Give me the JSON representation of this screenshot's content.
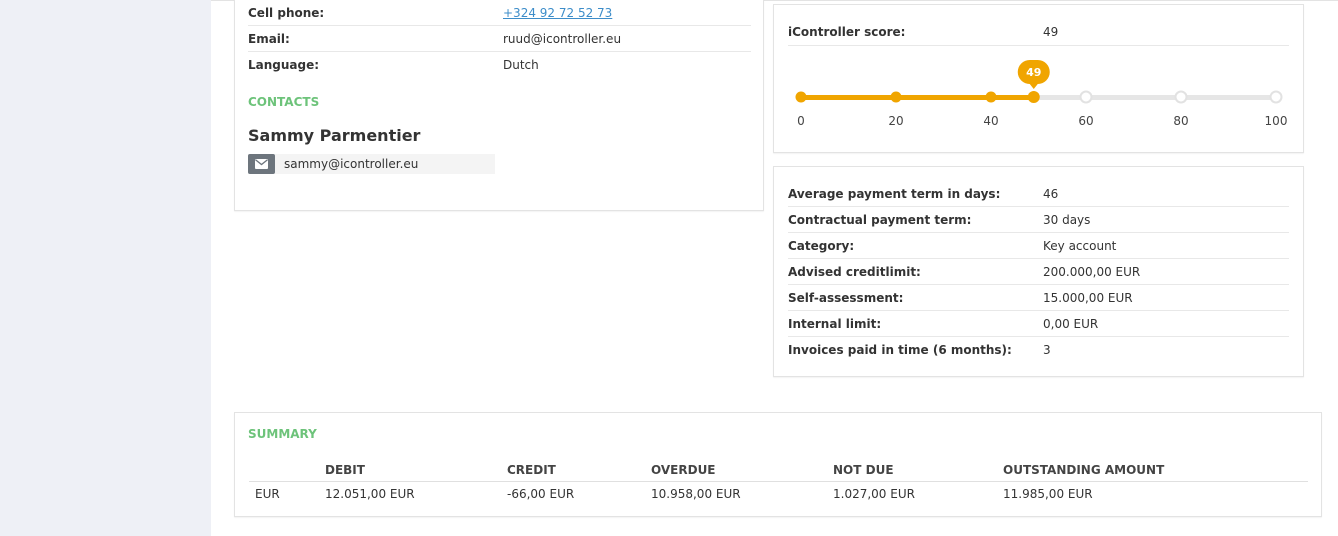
{
  "contact_info": {
    "rows": [
      {
        "label": "Cell phone:",
        "value": "+324 92 72 52 73"
      },
      {
        "label": "Email:",
        "value": "ruud@icontroller.eu"
      },
      {
        "label": "Language:",
        "value": "Dutch"
      }
    ],
    "contacts_title": "CONTACTS",
    "contact_name": "Sammy Parmentier",
    "contact_email": "sammy@icontroller.eu"
  },
  "score": {
    "label": "iController score:",
    "value": "49",
    "bubble": "49",
    "level": 49,
    "max": 100,
    "ticks": [
      "0",
      "20",
      "40",
      "60",
      "80",
      "100"
    ],
    "accent_color": "#f0a500"
  },
  "details": {
    "rows": [
      {
        "label": "Average payment term in days:",
        "value": "46"
      },
      {
        "label": "Contractual payment term:",
        "value": "30 days"
      },
      {
        "label": "Category:",
        "value": "Key account"
      },
      {
        "label": "Advised creditlimit:",
        "value": "200.000,00 EUR"
      },
      {
        "label": "Self-assessment:",
        "value": "15.000,00 EUR"
      },
      {
        "label": "Internal limit:",
        "value": "0,00 EUR"
      },
      {
        "label": "Invoices paid in time (6 months):",
        "value": "3"
      }
    ]
  },
  "summary": {
    "title": "SUMMARY",
    "headers": [
      "",
      "DEBIT",
      "CREDIT",
      "OVERDUE",
      "NOT DUE",
      "OUTSTANDING AMOUNT"
    ],
    "row": [
      "EUR",
      "12.051,00 EUR",
      "-66,00 EUR",
      "10.958,00 EUR",
      "1.027,00 EUR",
      "11.985,00 EUR"
    ]
  },
  "colors": {
    "section_title": "#6dc37a",
    "link": "#3d8dc9",
    "sidebar_bg": "#eef0f6"
  }
}
